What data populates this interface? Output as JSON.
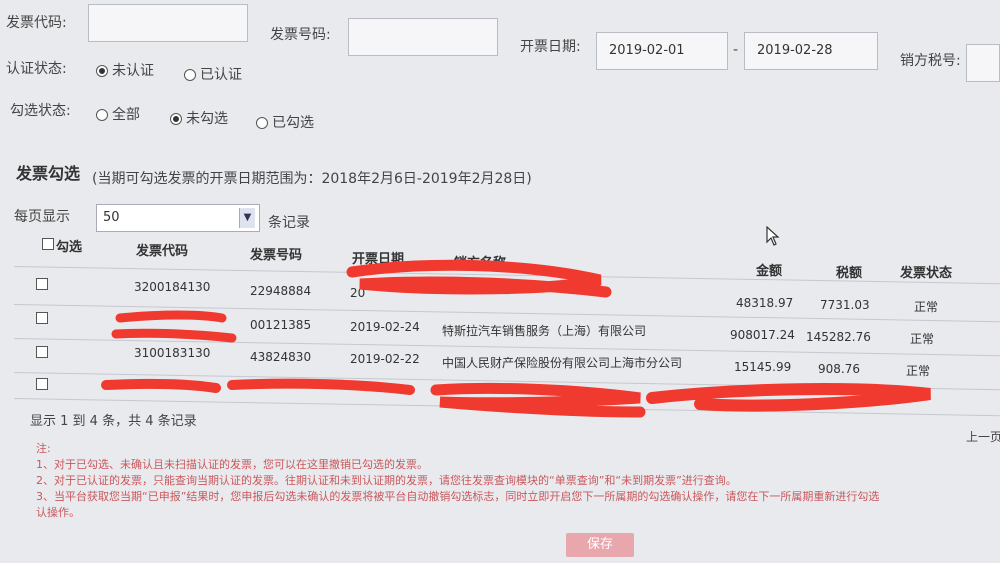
{
  "filters": {
    "invoice_code_label": "发票代码:",
    "invoice_code_value": "",
    "invoice_number_label": "发票号码:",
    "invoice_number_value": "",
    "issue_date_label": "开票日期:",
    "date_from": "2019-02-01",
    "date_sep": "-",
    "date_to": "2019-02-28",
    "seller_tax_label": "销方税号:",
    "seller_tax_value": "",
    "cert_status_label": "认证状态:",
    "cert_options": [
      "未认证",
      "已认证"
    ],
    "cert_selected": "未认证",
    "check_status_label": "勾选状态:",
    "check_options": [
      "全部",
      "未勾选",
      "已勾选"
    ],
    "check_selected": "未勾选"
  },
  "section": {
    "title": "发票勾选",
    "range_note": "(当期可勾选发票的开票日期范围为：2018年2月6日-2019年2月28日)"
  },
  "pager": {
    "per_page_label": "每页显示",
    "per_page_value": "50",
    "records_suffix": "条记录",
    "summary": "显示 1 到 4 条，共 4 条记录",
    "prev": "上一页"
  },
  "table": {
    "headers": [
      "勾选",
      "发票代码",
      "发票号码",
      "开票日期",
      "销方名称",
      "金额",
      "税额",
      "发票状态"
    ],
    "rows": [
      {
        "code": "3200184130",
        "number": "22948884",
        "date": "20",
        "seller": "",
        "amount": "48318.97",
        "tax": "7731.03",
        "status": "正常"
      },
      {
        "code": "",
        "number": "00121385",
        "date": "2019-02-24",
        "seller": "特斯拉汽车销售服务（上海）有限公司",
        "amount": "908017.24",
        "tax": "145282.76",
        "status": "正常"
      },
      {
        "code": "3100183130",
        "number": "43824830",
        "date": "2019-02-22",
        "seller": "中国人民财产保险股份有限公司上海市分公司",
        "amount": "15145.99",
        "tax": "908.76",
        "status": "正常"
      },
      {
        "code": "",
        "number": "",
        "date": "",
        "seller": "",
        "amount": "",
        "tax": "",
        "status": ""
      }
    ]
  },
  "notes": {
    "title": "注:",
    "lines": [
      "1、对于已勾选、未确认且未扫描认证的发票，您可以在这里撤销已勾选的发票。",
      "2、对于已认证的发票，只能查询当期认证的发票。往期认证和未到认证期的发票，请您往发票查询模块的“单票查询”和“未到期发票”进行查询。",
      "3、当平台获取您当期“已申报”结果时，您申报后勾选未确认的发票将被平台自动撤销勾选标志，同时立即开启您下一所属期的勾选确认操作，请您在下一所属期重新进行勾选",
      "认操作。"
    ]
  },
  "actions": {
    "save": "保存"
  },
  "colors": {
    "redaction": "#f03a2f",
    "note": "#c8585c",
    "save_bg": "#e7a7ad"
  }
}
